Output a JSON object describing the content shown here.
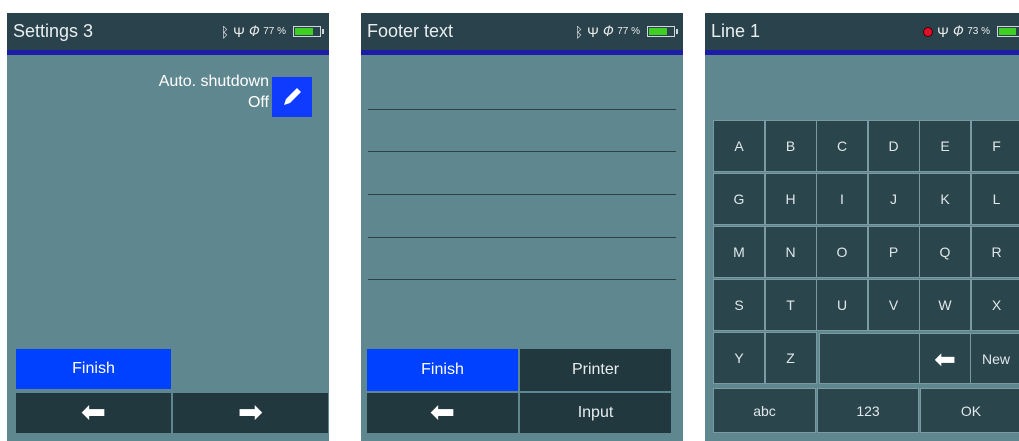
{
  "screen1": {
    "title": "Settings 3",
    "battery_percent": "77 %",
    "battery_level": 0.77,
    "setting_name": "Auto. shutdown",
    "setting_value": "Off",
    "finish_label": "Finish"
  },
  "screen2": {
    "title": "Footer text",
    "battery_percent": "77 %",
    "battery_level": 0.77,
    "finish_label": "Finish",
    "printer_label": "Printer",
    "input_label": "Input"
  },
  "screen3": {
    "title": "Line  1",
    "battery_percent": "73 %",
    "battery_level": 0.73,
    "keys_row1": [
      "A",
      "B",
      "C",
      "D",
      "E",
      "F"
    ],
    "keys_row2": [
      "G",
      "H",
      "I",
      "J",
      "K",
      "L"
    ],
    "keys_row3": [
      "M",
      "N",
      "O",
      "P",
      "Q",
      "R"
    ],
    "keys_row4": [
      "S",
      "T",
      "U",
      "V",
      "W",
      "X"
    ],
    "keys_row5": [
      "Y",
      "Z"
    ],
    "new_label": "New",
    "abc_label": "abc",
    "num_label": "123",
    "ok_label": "OK"
  },
  "icons": {
    "bluetooth": "bluetooth-icon",
    "usb": "usb-icon",
    "plug": "plug-icon",
    "record": "record-icon",
    "pencil": "pencil-icon",
    "left_arrow": "left-arrow-icon",
    "right_arrow": "right-arrow-icon"
  },
  "colors": {
    "screen_bg": "#5f8790",
    "title_bg": "#2a424b",
    "accent_blue": "#0040ff",
    "dark_button": "#22383f",
    "battery_green": "#3ecf22"
  }
}
